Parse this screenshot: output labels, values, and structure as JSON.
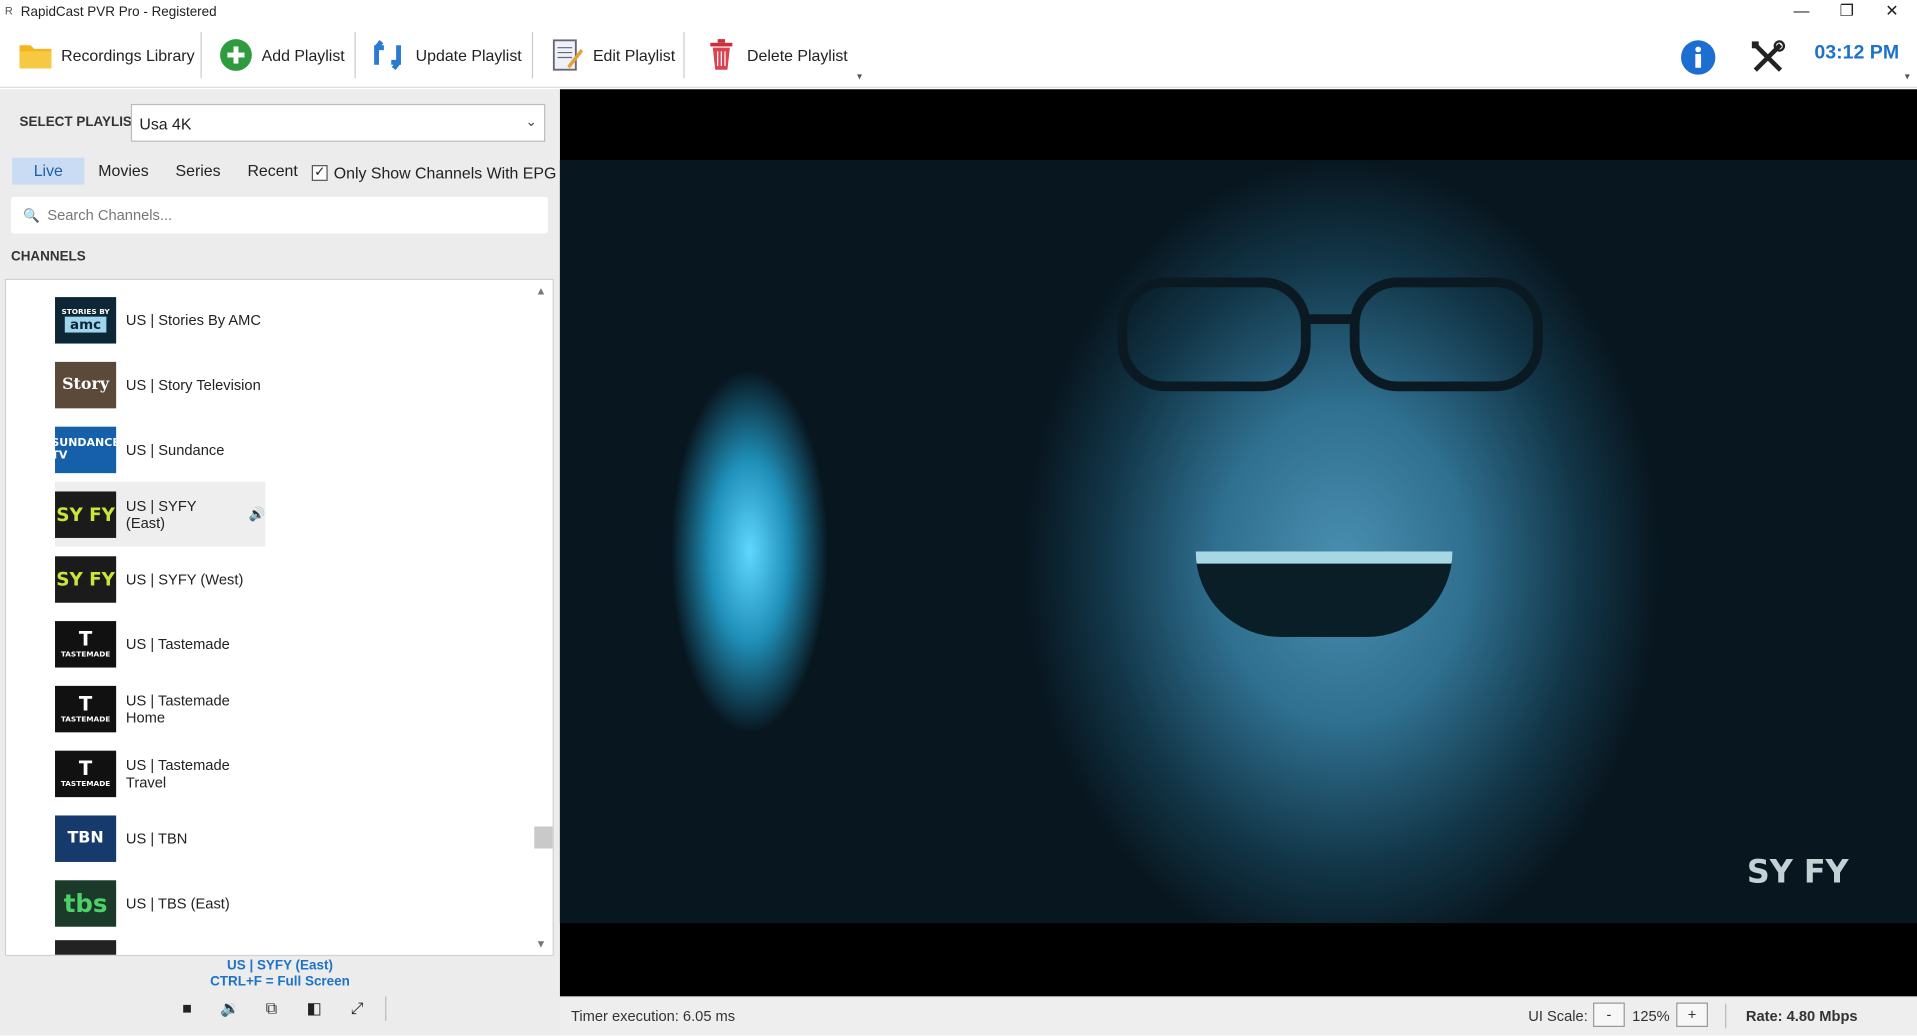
{
  "window": {
    "title": "RapidCast PVR Pro - Registered",
    "minimize": "—",
    "restore": "❐",
    "close": "✕"
  },
  "toolbar": {
    "recordings_library": "Recordings Library",
    "add_playlist": "Add Playlist",
    "update_playlist": "Update Playlist",
    "edit_playlist": "Edit Playlist",
    "delete_playlist": "Delete Playlist",
    "clock": "03:12 PM",
    "info_icon": "info-icon",
    "settings_icon": "tools-icon",
    "overflow_glyph": "▾",
    "colors": {
      "clock": "#1e73c8",
      "add_green": "#2e9b3e",
      "update_blue": "#2a7bd1",
      "delete_red": "#c9303c",
      "info_blue": "#1c6fd1"
    }
  },
  "playlist": {
    "select_label": "SELECT PLAYLIST:",
    "selected": "Usa 4K",
    "chevron": "⌄"
  },
  "tabs": [
    {
      "label": "Live",
      "active": true
    },
    {
      "label": "Movies",
      "active": false
    },
    {
      "label": "Series",
      "active": false
    },
    {
      "label": "Recent",
      "active": false
    }
  ],
  "epg_filter": {
    "label": "Only Show Channels With EPG",
    "checked": true,
    "check_glyph": "✓"
  },
  "search": {
    "placeholder": "Search Channels...",
    "icon": "🔍"
  },
  "channels_heading": "CHANNELS",
  "channels": [
    {
      "name": "US | Stories By AMC",
      "logo_line1": "STORIES BY",
      "logo_line2": "amc"
    },
    {
      "name": "US | Story Television",
      "logo_text": "Story"
    },
    {
      "name": "US | Sundance",
      "logo_text": "SUNDANCE TV"
    },
    {
      "name": "US | SYFY (East)",
      "logo_text": "SY FY",
      "playing": true,
      "audio_icon": "🔊"
    },
    {
      "name": "US | SYFY (West)",
      "logo_text": "SY FY"
    },
    {
      "name": "US | Tastemade",
      "logo_mark": "T",
      "logo_text": "TASTEMADE"
    },
    {
      "name": "US | Tastemade Home",
      "logo_mark": "T",
      "logo_text": "TASTEMADE"
    },
    {
      "name": "US | Tastemade Travel",
      "logo_mark": "T",
      "logo_text": "TASTEMADE"
    },
    {
      "name": "US | TBN",
      "logo_text": "TBN"
    },
    {
      "name": "US | TBS (East)",
      "logo_text": "tbs"
    }
  ],
  "scroll": {
    "up": "▲",
    "down": "▼"
  },
  "now_playing": {
    "channel": "US | SYFY (East)",
    "hint": "CTRL+F = Full Screen"
  },
  "player_controls": {
    "stop": "■",
    "audio": "🔉",
    "pip": "⧉",
    "window": "◧",
    "fullscreen": "⤢"
  },
  "video": {
    "watermark": "SY FY"
  },
  "status": {
    "timer": "Timer execution: 6.05 ms",
    "ui_scale_label": "UI Scale:",
    "minus": "-",
    "scale_value": "125%",
    "plus": "+",
    "rate": "Rate: 4.80 Mbps"
  }
}
